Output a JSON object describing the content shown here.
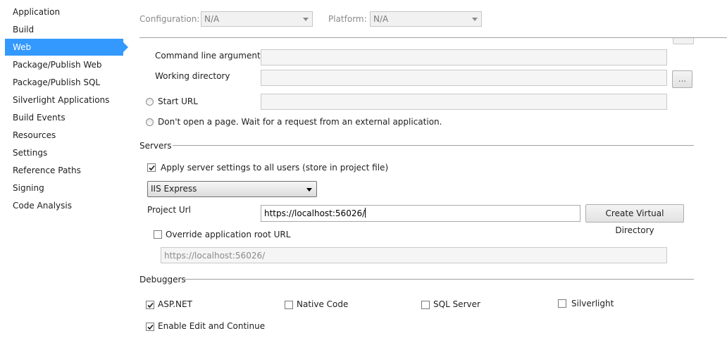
{
  "sidebar": {
    "items": [
      {
        "label": "Application"
      },
      {
        "label": "Build"
      },
      {
        "label": "Web",
        "selected": true
      },
      {
        "label": "Package/Publish Web"
      },
      {
        "label": "Package/Publish SQL"
      },
      {
        "label": "Silverlight Applications"
      },
      {
        "label": "Build Events"
      },
      {
        "label": "Resources"
      },
      {
        "label": "Settings"
      },
      {
        "label": "Reference Paths"
      },
      {
        "label": "Signing"
      },
      {
        "label": "Code Analysis"
      }
    ]
  },
  "header": {
    "configuration_label": "Configuration:",
    "configuration_value": "N/A",
    "platform_label": "Platform:",
    "platform_value": "N/A"
  },
  "start_action": {
    "command_line_label": "Command line arguments",
    "command_line_value": "",
    "working_dir_label": "Working directory",
    "working_dir_value": "",
    "browse_label": "...",
    "start_url_label": "Start URL",
    "start_url_value": "",
    "dont_open_label": "Don't open a page.  Wait for a request from an external application."
  },
  "servers": {
    "section_title": "Servers",
    "apply_all_label": "Apply server settings to all users (store in project file)",
    "apply_all_checked": true,
    "server_type": "IIS Express",
    "project_url_label": "Project Url",
    "project_url_value": "https://localhost:56026/",
    "create_vdir_label": "Create Virtual Directory",
    "override_label": "Override application root URL",
    "override_checked": false,
    "override_value": "https://localhost:56026/"
  },
  "debuggers": {
    "section_title": "Debuggers",
    "aspnet_label": "ASP.NET",
    "aspnet_checked": true,
    "native_label": "Native Code",
    "native_checked": false,
    "sql_label": "SQL Server",
    "sql_checked": false,
    "silverlight_label": "Silverlight",
    "silverlight_checked": false,
    "edit_continue_label": "Enable Edit and Continue",
    "edit_continue_checked": true
  },
  "colors": {
    "selection": "#3399ff",
    "separator": "#a0a0a0"
  }
}
